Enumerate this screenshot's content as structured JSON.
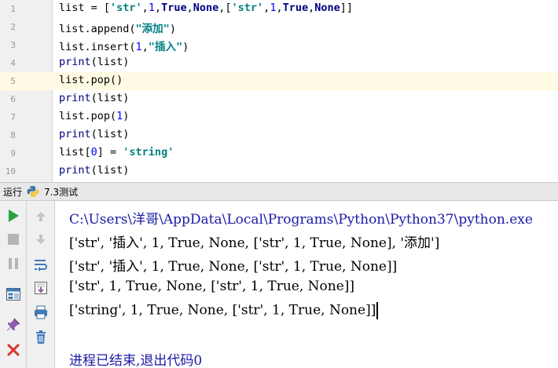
{
  "editor": {
    "current_line_index": 4,
    "lines": [
      {
        "num": "1",
        "tokens": [
          {
            "t": "list = [",
            "c": ""
          },
          {
            "t": "'str'",
            "c": "t-str"
          },
          {
            "t": ",",
            "c": ""
          },
          {
            "t": "1",
            "c": "t-num"
          },
          {
            "t": ",",
            "c": ""
          },
          {
            "t": "True",
            "c": "t-kw"
          },
          {
            "t": ",",
            "c": ""
          },
          {
            "t": "None",
            "c": "t-kw"
          },
          {
            "t": ",[",
            "c": ""
          },
          {
            "t": "'str'",
            "c": "t-str"
          },
          {
            "t": ",",
            "c": ""
          },
          {
            "t": "1",
            "c": "t-num"
          },
          {
            "t": ",",
            "c": ""
          },
          {
            "t": "True",
            "c": "t-kw"
          },
          {
            "t": ",",
            "c": ""
          },
          {
            "t": "None",
            "c": "t-kw"
          },
          {
            "t": "]]",
            "c": ""
          }
        ]
      },
      {
        "num": "2",
        "tokens": [
          {
            "t": "list.append(",
            "c": ""
          },
          {
            "t": "\"添加\"",
            "c": "t-str"
          },
          {
            "t": ")",
            "c": ""
          }
        ]
      },
      {
        "num": "3",
        "tokens": [
          {
            "t": "list.insert(",
            "c": ""
          },
          {
            "t": "1",
            "c": "t-num"
          },
          {
            "t": ",",
            "c": ""
          },
          {
            "t": "\"插入\"",
            "c": "t-str"
          },
          {
            "t": ")",
            "c": ""
          }
        ]
      },
      {
        "num": "4",
        "tokens": [
          {
            "t": "print",
            "c": "t-builtin"
          },
          {
            "t": "(list)",
            "c": ""
          }
        ]
      },
      {
        "num": "5",
        "tokens": [
          {
            "t": "list.pop()",
            "c": ""
          }
        ]
      },
      {
        "num": "6",
        "tokens": [
          {
            "t": "print",
            "c": "t-builtin"
          },
          {
            "t": "(list)",
            "c": ""
          }
        ]
      },
      {
        "num": "7",
        "tokens": [
          {
            "t": "list.pop(",
            "c": ""
          },
          {
            "t": "1",
            "c": "t-num"
          },
          {
            "t": ")",
            "c": ""
          }
        ]
      },
      {
        "num": "8",
        "tokens": [
          {
            "t": "print",
            "c": "t-builtin"
          },
          {
            "t": "(list)",
            "c": ""
          }
        ]
      },
      {
        "num": "9",
        "tokens": [
          {
            "t": "list[",
            "c": ""
          },
          {
            "t": "0",
            "c": "t-num"
          },
          {
            "t": "] = ",
            "c": ""
          },
          {
            "t": "'string'",
            "c": "t-str"
          }
        ]
      },
      {
        "num": "10",
        "tokens": [
          {
            "t": "print",
            "c": "t-builtin"
          },
          {
            "t": "(list)",
            "c": ""
          }
        ]
      }
    ]
  },
  "run_bar": {
    "label": "运行",
    "config_name": "7.3测试",
    "icon": "python-icon"
  },
  "toolbar_left": [
    {
      "name": "run-icon",
      "color": "#2aa33a"
    },
    {
      "name": "stop-icon",
      "color": "#b5b5b5"
    },
    {
      "name": "pause-icon",
      "color": "#b5b5b5"
    },
    {
      "name": "layout-icon",
      "color": "#3d7ab8"
    },
    {
      "name": "pin-icon",
      "color": "#8b5fa8"
    },
    {
      "name": "close-icon",
      "color": "#d9342b"
    }
  ],
  "toolbar_right": [
    {
      "name": "up-arrow-icon"
    },
    {
      "name": "down-arrow-icon"
    },
    {
      "name": "soft-wrap-icon"
    },
    {
      "name": "scroll-to-end-icon"
    },
    {
      "name": "print-icon"
    },
    {
      "name": "trash-icon"
    }
  ],
  "console": {
    "lines": [
      "C:\\Users\\洋哥\\AppData\\Local\\Programs\\Python\\Python37\\python.exe",
      "['str', '插入', 1, True, None, ['str', 1, True, None], '添加']",
      "['str', '插入', 1, True, None, ['str', 1, True, None]]",
      "['str', 1, True, None, ['str', 1, True, None]]",
      "['string', 1, True, None, ['str', 1, True, None]]",
      "",
      "进程已结束,退出代码0"
    ]
  }
}
